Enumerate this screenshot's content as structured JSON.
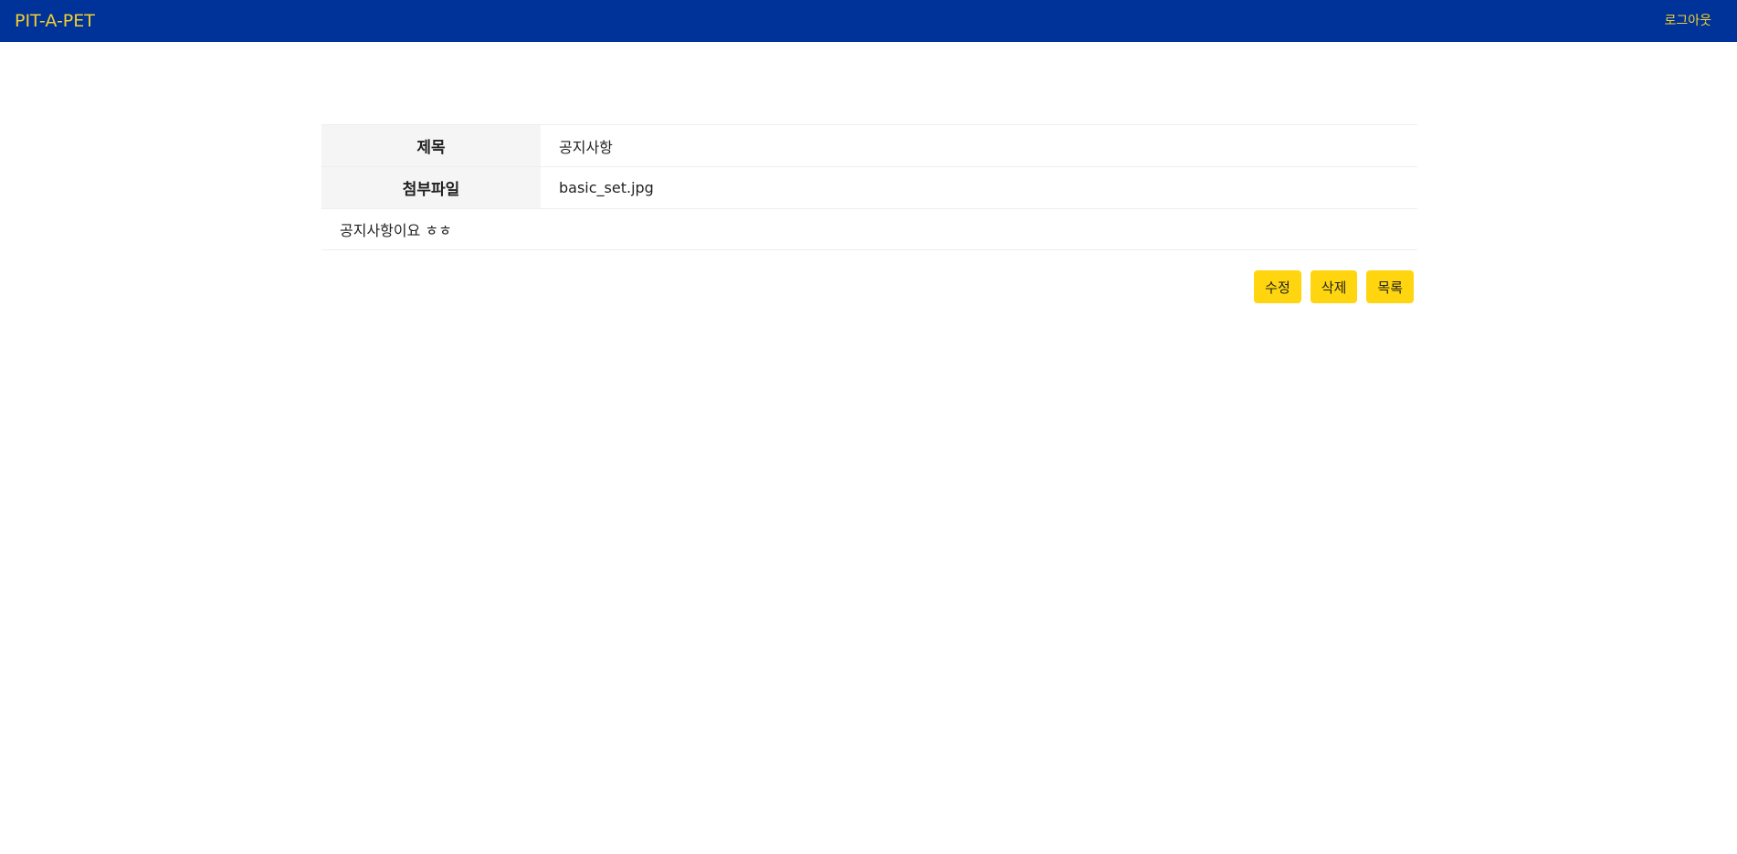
{
  "header": {
    "brand": "PIT-A-PET",
    "logout_label": "로그아웃"
  },
  "post": {
    "title_label": "제목",
    "title_value": "공지사항",
    "attachment_label": "첨부파일",
    "attachment_value": "basic_set.jpg",
    "content": "공지사항이요 ㅎㅎ"
  },
  "actions": {
    "edit_label": "수정",
    "delete_label": "삭제",
    "list_label": "목록"
  },
  "colors": {
    "header_bg": "#00339a",
    "brand_text": "#f5cf2a",
    "button_bg": "#ffd50f"
  }
}
